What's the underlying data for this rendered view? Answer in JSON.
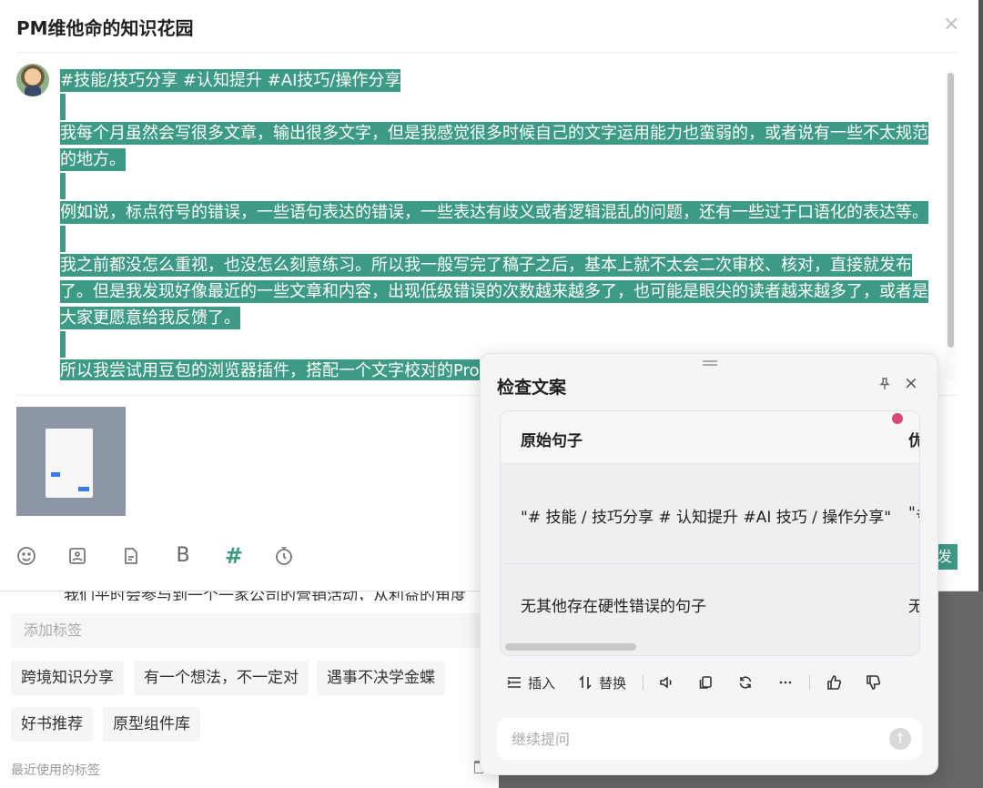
{
  "modal": {
    "title": "PM维他命的知识花园",
    "close_glyph": "×"
  },
  "editor": {
    "lines": [
      "#技能/技巧分享 #认知提升 #AI技巧/操作分享 ",
      "",
      "我每个月虽然会写很多文章，输出很多文字，但是我感觉很多时候自己的文字运用能力也蛮弱的，或者说有一些不太规范",
      "的地方。",
      "",
      "例如说，标点符号的错误，一些语句表达的错误，一些表达有歧义或者逻辑混乱的问题，还有一些过于口语化的表达等。",
      "",
      "我之前都没怎么重视，也没怎么刻意练习。所以我一般写完了稿子之后，基本上就不太会二次审校、核对，直接就发布",
      "了。但是我发现好像最近的一些文章和内容，出现低级错误的次数越来越多了，也可能是眼尖的读者越来越多了，或者是",
      "大家更愿意给我反馈了。",
      "",
      "所以我尝试用豆包的浏览器插件，搭配一个文字校对的Pro"
    ]
  },
  "toolbar": {
    "items": [
      "emoji-icon",
      "image-icon",
      "document-icon",
      "bold-icon",
      "hashtag-icon",
      "timer-icon"
    ],
    "bold_glyph": "B",
    "hash_glyph": "#",
    "send_label": "发"
  },
  "background_page": {
    "strip_text": "我们平时会参与到一个一家公司的营销活动，从利益的角度",
    "tag_placeholder": "添加标签",
    "tags": [
      "跨境知识分享",
      "有一个想法，不一定对",
      "遇事不决学金蝶",
      "好书推荐",
      "原型组件库"
    ],
    "recent_label": "最近使用的标签"
  },
  "panel": {
    "title": "检查文案",
    "close_glyph": "×",
    "table": {
      "headers": [
        "原始句子",
        "优"
      ],
      "rows": [
        [
          "\"# 技能 / 技巧分享 # 认知提升 #AI 技巧 / 操作分享\"",
          "\"#"
        ],
        [
          "无其他存在硬性错误的句子",
          "无"
        ]
      ]
    },
    "actions": {
      "insert": "插入",
      "replace": "替换"
    },
    "followup_placeholder": "继续提问",
    "send_glyph": "↑"
  }
}
